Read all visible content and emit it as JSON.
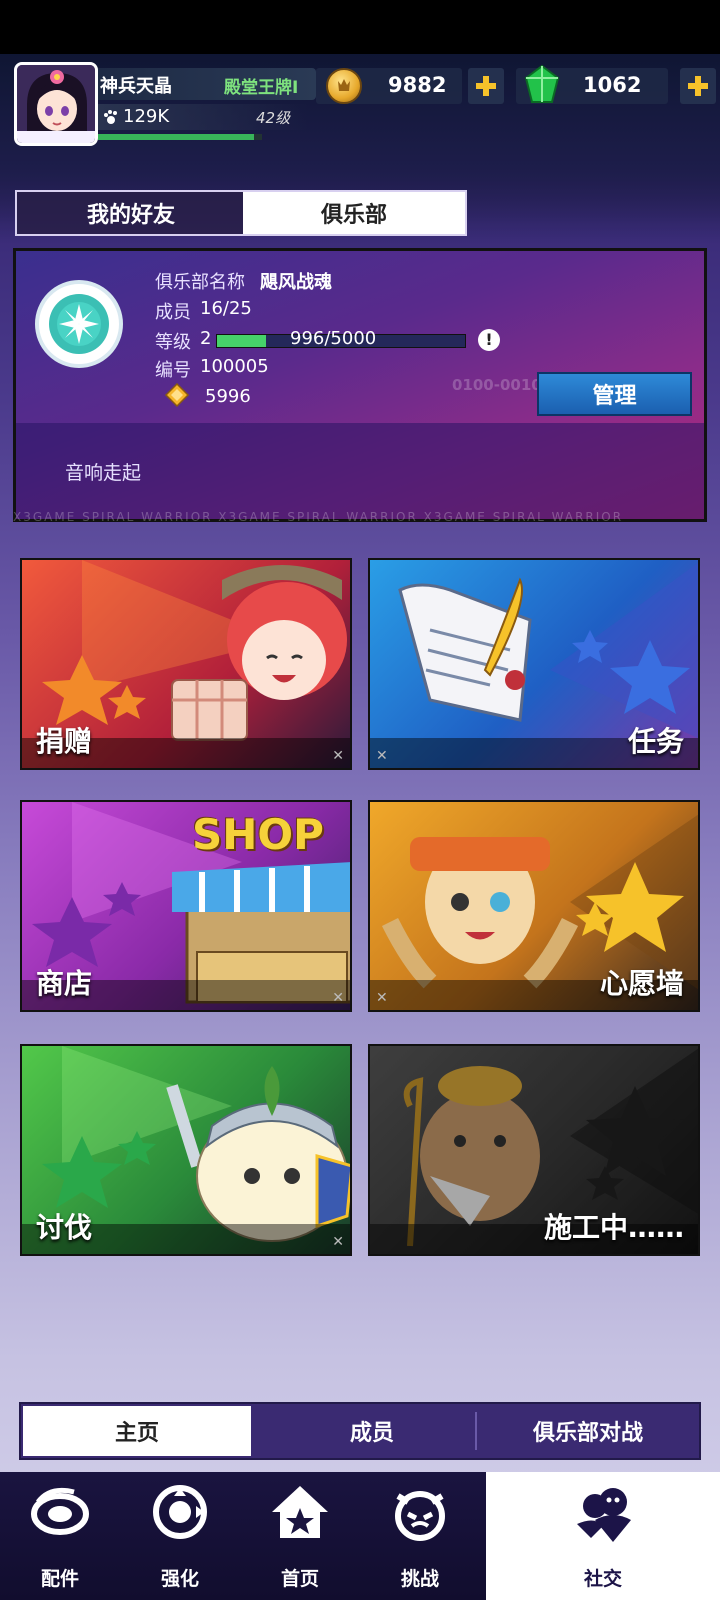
{
  "player": {
    "name": "神兵天晶",
    "title": "殿堂王牌Ⅰ",
    "power": "129K",
    "level": "42级",
    "xp_progress": 0.95
  },
  "currency": {
    "gold": "9882",
    "gems": "1062",
    "gold_icon": "coin-icon",
    "gem_icon": "gem-icon",
    "plus_icon": "plus-icon"
  },
  "tabs": {
    "friends": "我的好友",
    "club": "俱乐部",
    "active": "club"
  },
  "club": {
    "name_label": "俱乐部名称",
    "name": "飓风战魂",
    "members_label": "成员",
    "members": "16/25",
    "level_label": "等级",
    "level": "2",
    "exp_text": "996/5000",
    "exp_progress": 0.1992,
    "id_label": "编号",
    "id": "100005",
    "funds": "5996",
    "manage_label": "管理",
    "motto": "音响走起",
    "watermark_code": "0100-0010",
    "watermark_text": "X3GAME SPIRAL WARRIOR   X3GAME SPIRAL WARRIOR   X3GAME SPIRAL WARRIOR"
  },
  "features": [
    {
      "label": "捐赠",
      "color": "#e0433a"
    },
    {
      "label": "任务",
      "color": "#2f6fd1"
    },
    {
      "label": "商店",
      "color": "#a83cc8"
    },
    {
      "label": "心愿墙",
      "color": "#d98a1c"
    },
    {
      "label": "讨伐",
      "color": "#3aa845"
    },
    {
      "label": "施工中……",
      "color": "#3a3a3a"
    }
  ],
  "shop_sign": "SHOP",
  "bottom_tabs": {
    "home": "主页",
    "members": "成员",
    "battle": "俱乐部对战",
    "active": "home"
  },
  "nav": [
    {
      "label": "配件",
      "icon": "parts-icon"
    },
    {
      "label": "强化",
      "icon": "upgrade-icon"
    },
    {
      "label": "首页",
      "icon": "home-icon"
    },
    {
      "label": "挑战",
      "icon": "challenge-icon"
    },
    {
      "label": "社交",
      "icon": "social-icon",
      "active": true
    }
  ],
  "accent": "#46d26a"
}
